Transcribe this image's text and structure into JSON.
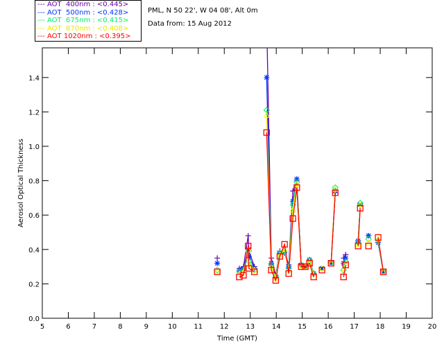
{
  "header": {
    "site": "PML, N 50 22', W 04 08', Alt 0m",
    "date": "Data from: 15 Aug 2012"
  },
  "chart_data": {
    "type": "line",
    "xlabel": "Time (GMT)",
    "ylabel": "Aerosol Optical Thickness",
    "xlim": [
      5,
      20
    ],
    "ylim": [
      0,
      1.58
    ],
    "xticks": [
      5,
      6,
      7,
      8,
      9,
      10,
      11,
      12,
      13,
      14,
      15,
      16,
      17,
      18,
      19,
      20
    ],
    "yticks": [
      "0.0",
      "0.2",
      "0.4",
      "0.6",
      "0.8",
      "1.0",
      "1.2",
      "1.4"
    ],
    "legend_position": "top-left-outside",
    "x": [
      11.73,
      12.58,
      12.74,
      12.92,
      12.95,
      13.16,
      13.63,
      13.81,
      13.98,
      14.14,
      14.32,
      14.48,
      14.64,
      14.79,
      14.96,
      15.12,
      15.28,
      15.44,
      15.76,
      16.11,
      16.27,
      16.59,
      16.67,
      17.15,
      17.23,
      17.55,
      17.92,
      18.12
    ],
    "series": [
      {
        "name": "AOT  400nm : <0.445>",
        "color": "#6600aa",
        "marker": "plus",
        "values": [
          0.35,
          0.29,
          0.3,
          0.48,
          0.39,
          0.3,
          1.75,
          0.35,
          0.25,
          0.39,
          0.39,
          0.31,
          0.74,
          0.8,
          0.31,
          0.3,
          0.34,
          0.26,
          0.29,
          0.32,
          0.73,
          0.35,
          0.37,
          0.45,
          0.66,
          0.48,
          0.44,
          0.27
        ]
      },
      {
        "name": "AOT  500nm : <0.428>",
        "color": "#0033ff",
        "marker": "asterisk",
        "values": [
          0.32,
          0.28,
          0.29,
          0.4,
          0.36,
          0.29,
          1.4,
          0.32,
          0.24,
          0.38,
          0.38,
          0.3,
          0.68,
          0.81,
          0.31,
          0.3,
          0.34,
          0.26,
          0.29,
          0.32,
          0.74,
          0.32,
          0.35,
          0.45,
          0.66,
          0.48,
          0.44,
          0.27
        ]
      },
      {
        "name": "AOT  675nm : <0.415>",
        "color": "#00ee66",
        "marker": "diamond",
        "values": [
          0.28,
          0.27,
          0.28,
          0.39,
          0.33,
          0.28,
          1.21,
          0.31,
          0.24,
          0.38,
          0.39,
          0.29,
          0.66,
          0.79,
          0.31,
          0.3,
          0.34,
          0.26,
          0.29,
          0.32,
          0.76,
          0.28,
          0.33,
          0.44,
          0.67,
          0.46,
          0.45,
          0.27
        ]
      },
      {
        "name": "AOT  870nm : <0.408>",
        "color": "#ffff00",
        "marker": "triangle",
        "values": [
          0.27,
          0.26,
          0.27,
          0.4,
          0.31,
          0.28,
          1.18,
          0.3,
          0.23,
          0.37,
          0.4,
          0.28,
          0.63,
          0.78,
          0.3,
          0.3,
          0.33,
          0.25,
          0.29,
          0.32,
          0.75,
          0.27,
          0.32,
          0.43,
          0.66,
          0.44,
          0.46,
          0.27
        ]
      },
      {
        "name": "AOT 1020nm : <0.395>",
        "color": "#ff0000",
        "marker": "square",
        "values": [
          0.27,
          0.24,
          0.25,
          0.42,
          0.29,
          0.27,
          1.08,
          0.28,
          0.22,
          0.36,
          0.43,
          0.26,
          0.58,
          0.76,
          0.3,
          0.3,
          0.32,
          0.24,
          0.28,
          0.32,
          0.73,
          0.24,
          0.31,
          0.42,
          0.64,
          0.42,
          0.47,
          0.27
        ]
      }
    ]
  }
}
